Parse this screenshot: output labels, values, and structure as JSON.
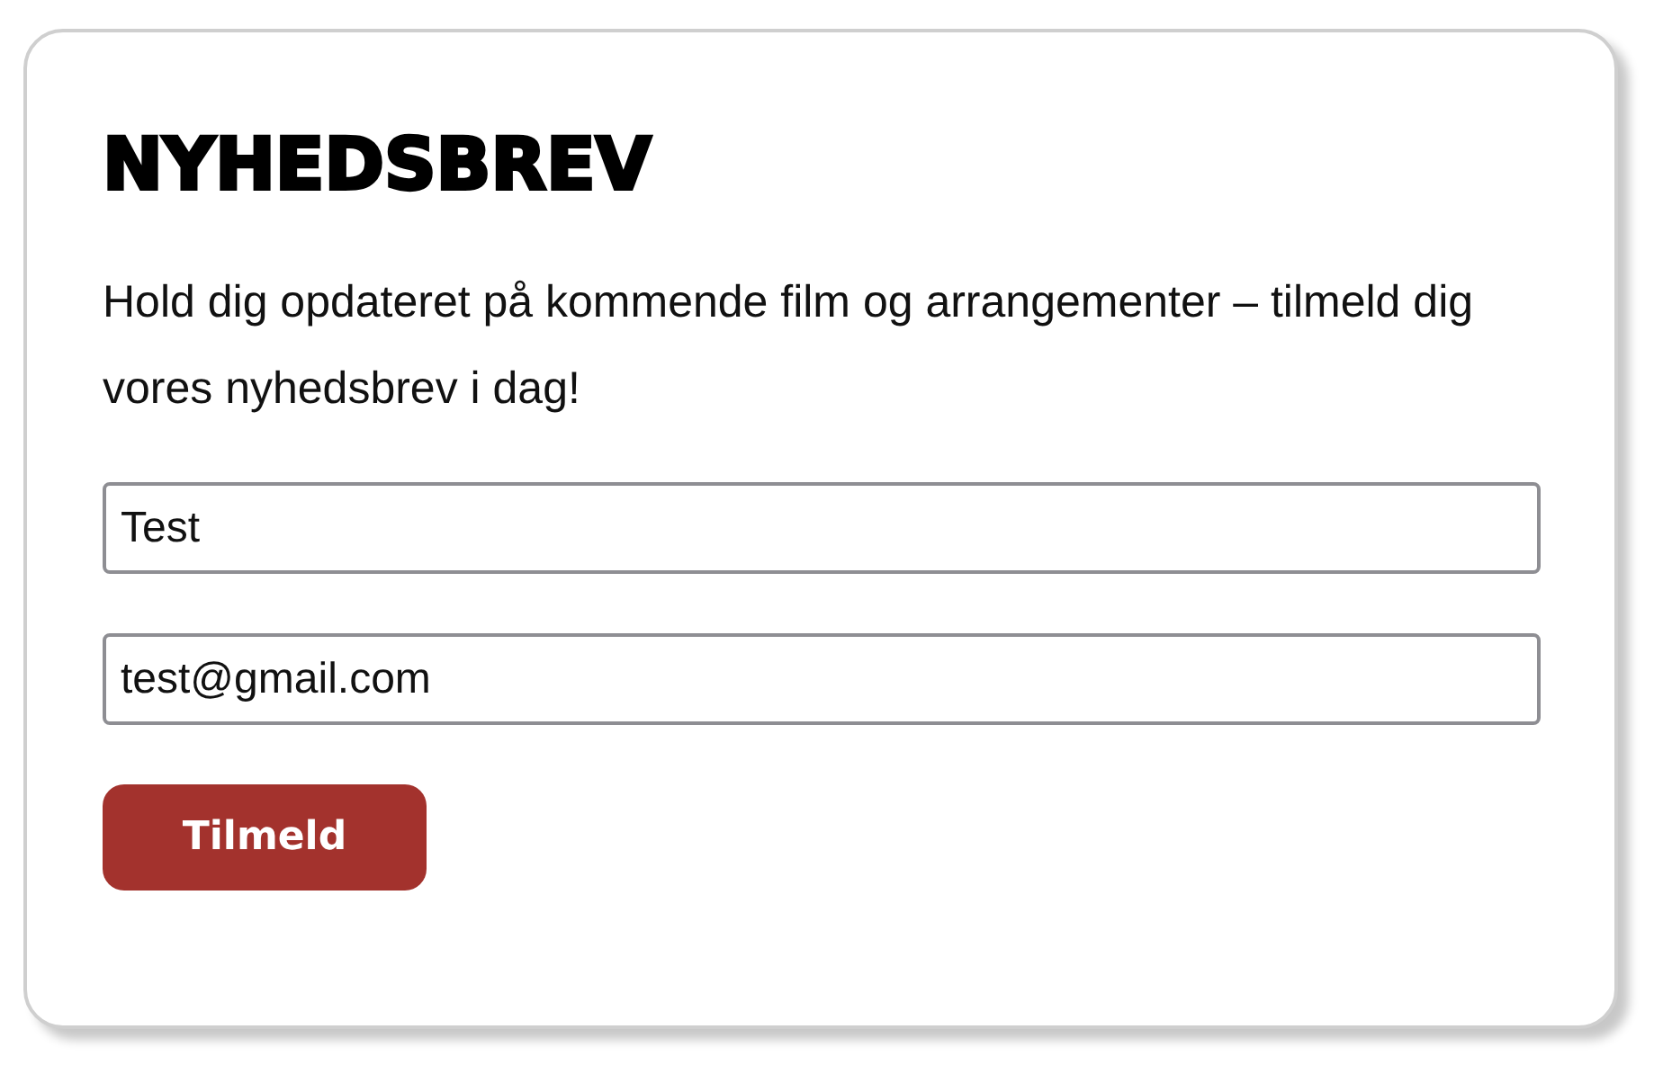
{
  "heading": "NYHEDSBREV",
  "intro": "Hold dig opdateret på kommende film og arrangementer – tilmeld dig vores nyhedsbrev i dag!",
  "fields": [
    {
      "value": "Test"
    },
    {
      "value": "test@gmail.com"
    }
  ],
  "submit_button": "Tilmeld"
}
